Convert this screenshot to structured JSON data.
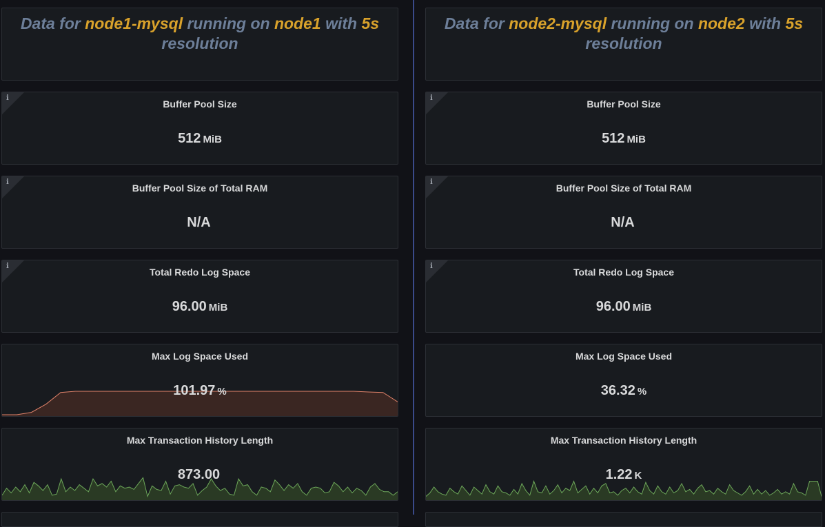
{
  "columns": [
    {
      "title": {
        "p1": "Data for ",
        "service": "node1-mysql",
        "p2": " running on ",
        "node": "node1",
        "p3": " with ",
        "res": "5s",
        "p4": "resolution"
      },
      "panels": [
        {
          "title": "Buffer Pool Size",
          "value": "512",
          "unit": "MiB",
          "info": "i"
        },
        {
          "title": "Buffer Pool Size of Total RAM",
          "value": "N/A",
          "unit": "",
          "info": "i"
        },
        {
          "title": "Total Redo Log Space",
          "value": "96.00",
          "unit": "MiB",
          "info": "i"
        },
        {
          "title": "Max Log Space Used",
          "value": "101.97",
          "unit": "%"
        },
        {
          "title": "Max Transaction History Length",
          "value": "873.00",
          "unit": ""
        }
      ]
    },
    {
      "title": {
        "p1": "Data for ",
        "service": "node2-mysql",
        "p2": " running on ",
        "node": "node2",
        "p3": " with ",
        "res": "5s",
        "p4": "resolution"
      },
      "panels": [
        {
          "title": "Buffer Pool Size",
          "value": "512",
          "unit": "MiB",
          "info": "i"
        },
        {
          "title": "Buffer Pool Size of Total RAM",
          "value": "N/A",
          "unit": "",
          "info": "i"
        },
        {
          "title": "Total Redo Log Space",
          "value": "96.00",
          "unit": "MiB",
          "info": "i"
        },
        {
          "title": "Max Log Space Used",
          "value": "36.32",
          "unit": "%"
        },
        {
          "title": "Max Transaction History Length",
          "value": "1.22",
          "unit": "K"
        }
      ]
    }
  ],
  "colors": {
    "accent": "#d9a22b",
    "title_text": "#6d7f99",
    "red_line": "#e0826a",
    "red_fill": "#3a2622",
    "green_line": "#6da85a",
    "green_fill": "#2a3a24"
  },
  "sparklines": {
    "node1_log_space": [
      0,
      0,
      0.1,
      0.45,
      0.95,
      1,
      1,
      1,
      1,
      1,
      1,
      1,
      1,
      1,
      1,
      1,
      1,
      1,
      1,
      1,
      1,
      1,
      1,
      1,
      1,
      0.97,
      0.95,
      0.55
    ],
    "node1_history": [
      0.15,
      0.45,
      0.25,
      0.5,
      0.3,
      0.6,
      0.25,
      0.7,
      0.55,
      0.35,
      0.6,
      0.15,
      0.2,
      0.85,
      0.3,
      0.5,
      0.35,
      0.6,
      0.45,
      0.3,
      0.85,
      0.55,
      0.65,
      0.5,
      0.75,
      0.3,
      0.55,
      0.45,
      0.5,
      0.4,
      0.65,
      0.9,
      0.1,
      0.55,
      0.4,
      0.35,
      0.75,
      0.2,
      0.55,
      0.6,
      0.5,
      0.45,
      0.65,
      0.15,
      0.35,
      0.5,
      0.85,
      0.55,
      0.35,
      0.45,
      0.2,
      0.15,
      0.85,
      0.55,
      0.6,
      0.3,
      0.15,
      0.5,
      0.45,
      0.3,
      0.8,
      0.6,
      0.35,
      0.6,
      0.45,
      0.65,
      0.3,
      0.15,
      0.45,
      0.5,
      0.45,
      0.25,
      0.3,
      0.7,
      0.55,
      0.3,
      0.5,
      0.25,
      0.45,
      0.35,
      0.15,
      0.5,
      0.65,
      0.4,
      0.3,
      0.3,
      0.15,
      0.3
    ],
    "node2_history": [
      0.1,
      0.25,
      0.5,
      0.3,
      0.2,
      0.15,
      0.45,
      0.3,
      0.2,
      0.55,
      0.35,
      0.15,
      0.5,
      0.35,
      0.2,
      0.6,
      0.3,
      0.2,
      0.55,
      0.3,
      0.25,
      0.15,
      0.4,
      0.2,
      0.65,
      0.35,
      0.15,
      0.75,
      0.3,
      0.25,
      0.55,
      0.2,
      0.35,
      0.6,
      0.25,
      0.45,
      0.35,
      0.75,
      0.25,
      0.4,
      0.55,
      0.2,
      0.45,
      0.25,
      0.55,
      0.65,
      0.25,
      0.3,
      0.15,
      0.35,
      0.45,
      0.25,
      0.5,
      0.3,
      0.2,
      0.7,
      0.35,
      0.2,
      0.55,
      0.3,
      0.2,
      0.5,
      0.25,
      0.35,
      0.65,
      0.3,
      0.4,
      0.2,
      0.45,
      0.6,
      0.3,
      0.35,
      0.2,
      0.45,
      0.3,
      0.2,
      0.6,
      0.35,
      0.25,
      0.15,
      0.3,
      0.55,
      0.2,
      0.4,
      0.2,
      0.35,
      0.15,
      0.25,
      0.4,
      0.2,
      0.3,
      0.2,
      0.65,
      0.3,
      0.25,
      0.15,
      0.75,
      0.75,
      0.75,
      0.1
    ]
  }
}
